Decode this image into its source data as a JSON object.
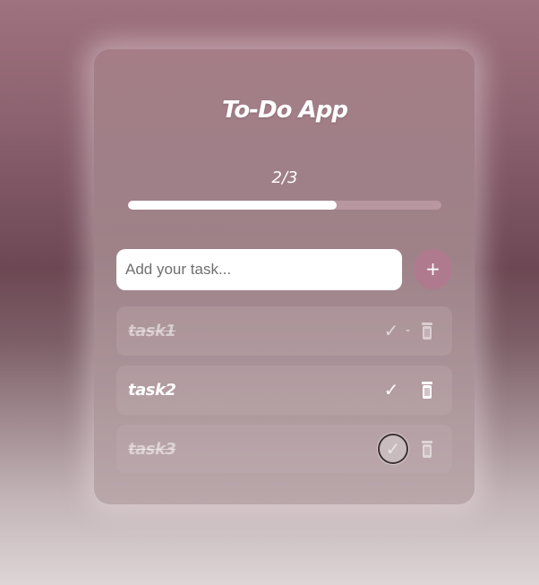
{
  "app": {
    "title": "To-Do App"
  },
  "progress": {
    "text": "2/3",
    "completed": 2,
    "total": 3,
    "fraction": 0.667
  },
  "input": {
    "placeholder": "Add your task...",
    "value": ""
  },
  "add_button": {
    "label": "+"
  },
  "tasks": [
    {
      "label": "task1",
      "completed": true,
      "check_glyph": "✓",
      "separator": "-"
    },
    {
      "label": "task2",
      "completed": false,
      "check_glyph": "✓",
      "separator": ""
    },
    {
      "label": "task3",
      "completed": true,
      "check_glyph": "✓",
      "separator": ""
    }
  ],
  "icons": {
    "check": "check-icon",
    "delete": "trash-icon"
  },
  "colors": {
    "accent": "#b07a8e",
    "progress_fill": "#ffffff",
    "progress_track": "#cda9b4"
  }
}
